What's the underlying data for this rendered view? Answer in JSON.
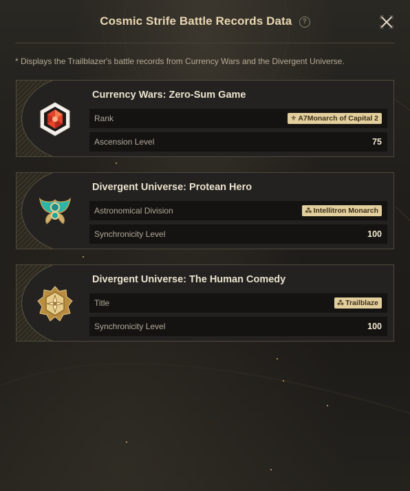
{
  "header": {
    "title": "Cosmic Strife Battle Records Data",
    "help_icon": "help-circle-icon",
    "close_icon": "close-icon"
  },
  "note": "* Displays the Trailblazer's battle records from Currency Wars and the Divergent Universe.",
  "colors": {
    "title": "#e9d7b3",
    "tag_bg": "#e3cf9e",
    "tag_text": "#3b2f16"
  },
  "cards": [
    {
      "title": "Currency Wars: Zero-Sum Game",
      "badge_icon": "red-gem-hexagon-icon",
      "rows": [
        {
          "label": "Rank",
          "value": "A7Monarch of Capital 2",
          "tag_icon": "rank-emblem-icon"
        },
        {
          "label": "Ascension Level",
          "value": "75"
        }
      ]
    },
    {
      "title": "Divergent Universe: Protean Hero",
      "badge_icon": "teal-winged-emblem-icon",
      "rows": [
        {
          "label": "Astronomical Division",
          "value": "Intellitron Monarch",
          "tag_icon": "division-emblem-icon"
        },
        {
          "label": "Synchronicity Level",
          "value": "100"
        }
      ]
    },
    {
      "title": "Divergent Universe: The Human Comedy",
      "badge_icon": "gold-star-hexagon-icon",
      "rows": [
        {
          "label": "Title",
          "value": "Trailblaze",
          "tag_icon": "trailblaze-emblem-icon"
        },
        {
          "label": "Synchronicity Level",
          "value": "100"
        }
      ]
    }
  ]
}
